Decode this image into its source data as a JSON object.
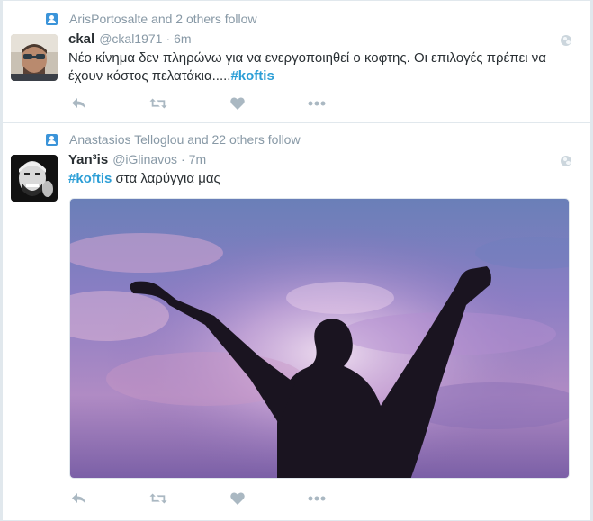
{
  "timeline": {
    "tweets": [
      {
        "context": "ArisPortosalte and 2 others follow",
        "name": "ckal",
        "handle": "@ckal1971",
        "separator": "·",
        "time": "6m",
        "text_plain": "Νέο κίνημα δεν πληρώνω για να ενεργοποιηθεί ο κοφτης. Οι επιλογές πρέπει να έχουν κόστος πελατάκια.....",
        "hashtag": "#koftis",
        "has_media": false
      },
      {
        "context": "Anastasios Telloglou and 22 others follow",
        "name": "Yan³is",
        "handle": "@iGlinavos",
        "separator": "·",
        "time": "7m",
        "hashtag": "#koftis",
        "text_after": " στα λαρύγγια μας",
        "has_media": true,
        "media_description": "silhouette of man with raised fists against purple sky"
      }
    ]
  },
  "icons": {
    "context": "follow-context-icon",
    "reply": "reply-icon",
    "retweet": "retweet-icon",
    "like": "heart-icon",
    "more": "more-icon",
    "privacy": "globe-icon"
  },
  "colors": {
    "hashtag": "#2b9ed6",
    "muted": "#8899a6",
    "text": "#292f33",
    "action_icon": "#aab8c2",
    "context_icon": "#3b94d9"
  }
}
